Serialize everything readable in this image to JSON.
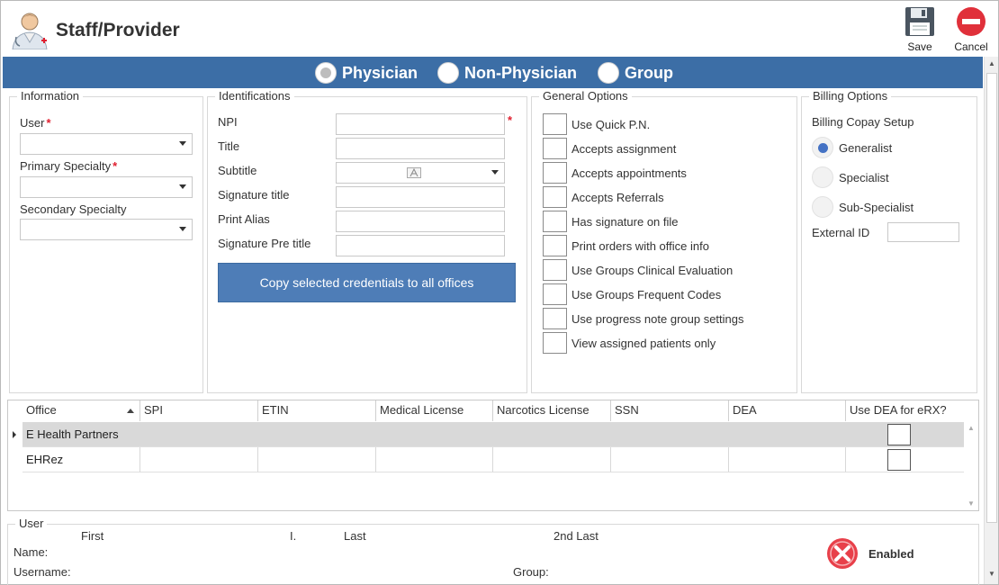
{
  "header": {
    "title": "Staff/Provider",
    "save_label": "Save",
    "cancel_label": "Cancel"
  },
  "provider_types": [
    {
      "label": "Physician",
      "selected": true
    },
    {
      "label": "Non-Physician",
      "selected": false
    },
    {
      "label": "Group",
      "selected": false
    }
  ],
  "information": {
    "title": "Information",
    "user_label": "User",
    "user_value": "",
    "primary_specialty_label": "Primary Specialty",
    "primary_specialty_value": "",
    "secondary_specialty_label": "Secondary Specialty",
    "secondary_specialty_value": "",
    "required_mark": "*"
  },
  "identifications": {
    "title": "Identifications",
    "npi_label": "NPI",
    "npi_value": "",
    "title_label": "Title",
    "title_value": "",
    "subtitle_label": "Subtitle",
    "subtitle_value": "",
    "signature_title_label": "Signature title",
    "signature_title_value": "",
    "print_alias_label": "Print Alias",
    "print_alias_value": "",
    "signature_pre_title_label": "Signature Pre title",
    "signature_pre_title_value": "",
    "copy_button_label": "Copy selected credentials to all offices"
  },
  "general_options": {
    "title": "General Options",
    "items": [
      {
        "label": "Use Quick P.N.",
        "checked": false
      },
      {
        "label": "Accepts assignment",
        "checked": false
      },
      {
        "label": "Accepts appointments",
        "checked": false
      },
      {
        "label": "Accepts Referrals",
        "checked": false
      },
      {
        "label": "Has signature on file",
        "checked": false
      },
      {
        "label": "Print orders with office info",
        "checked": false
      },
      {
        "label": "Use Groups Clinical Evaluation",
        "checked": false
      },
      {
        "label": "Use Groups Frequent Codes",
        "checked": false
      },
      {
        "label": "Use progress note group settings",
        "checked": false
      },
      {
        "label": "View assigned patients only",
        "checked": false
      }
    ]
  },
  "billing_options": {
    "title": "Billing Options",
    "copay_setup_label": "Billing Copay Setup",
    "options": [
      {
        "label": "Generalist",
        "selected": true
      },
      {
        "label": "Specialist",
        "selected": false
      },
      {
        "label": "Sub-Specialist",
        "selected": false
      }
    ],
    "external_id_label": "External ID",
    "external_id_value": ""
  },
  "offices_grid": {
    "columns": [
      "Office",
      "SPI",
      "ETIN",
      "Medical License",
      "Narcotics License",
      "SSN",
      "DEA",
      "Use DEA for eRX?"
    ],
    "rows": [
      {
        "office": "E Health Partners",
        "spi": "",
        "etin": "",
        "medical_license": "",
        "narcotics_license": "",
        "ssn": "",
        "dea": "",
        "use_dea": false,
        "selected": true
      },
      {
        "office": "EHRez",
        "spi": "",
        "etin": "",
        "medical_license": "",
        "narcotics_license": "",
        "ssn": "",
        "dea": "",
        "use_dea": false,
        "selected": false
      }
    ]
  },
  "user_section": {
    "title": "User",
    "first_label": "First",
    "initial_label": "I.",
    "last_label": "Last",
    "second_last_label": "2nd Last",
    "name_label": "Name:",
    "username_label": "Username:",
    "group_label": "Group:",
    "status_label": "Enabled"
  },
  "colors": {
    "accent_bar": "#3c6ea6",
    "button_blue": "#4e7db7",
    "required": "#e02030",
    "cancel_red": "#e0303a",
    "radio_selected": "#4472c4"
  },
  "icons": {
    "app": "staff-provider-icon",
    "save": "floppy-disk-icon",
    "cancel": "no-entry-icon",
    "enabled_status": "x-circle-icon"
  }
}
